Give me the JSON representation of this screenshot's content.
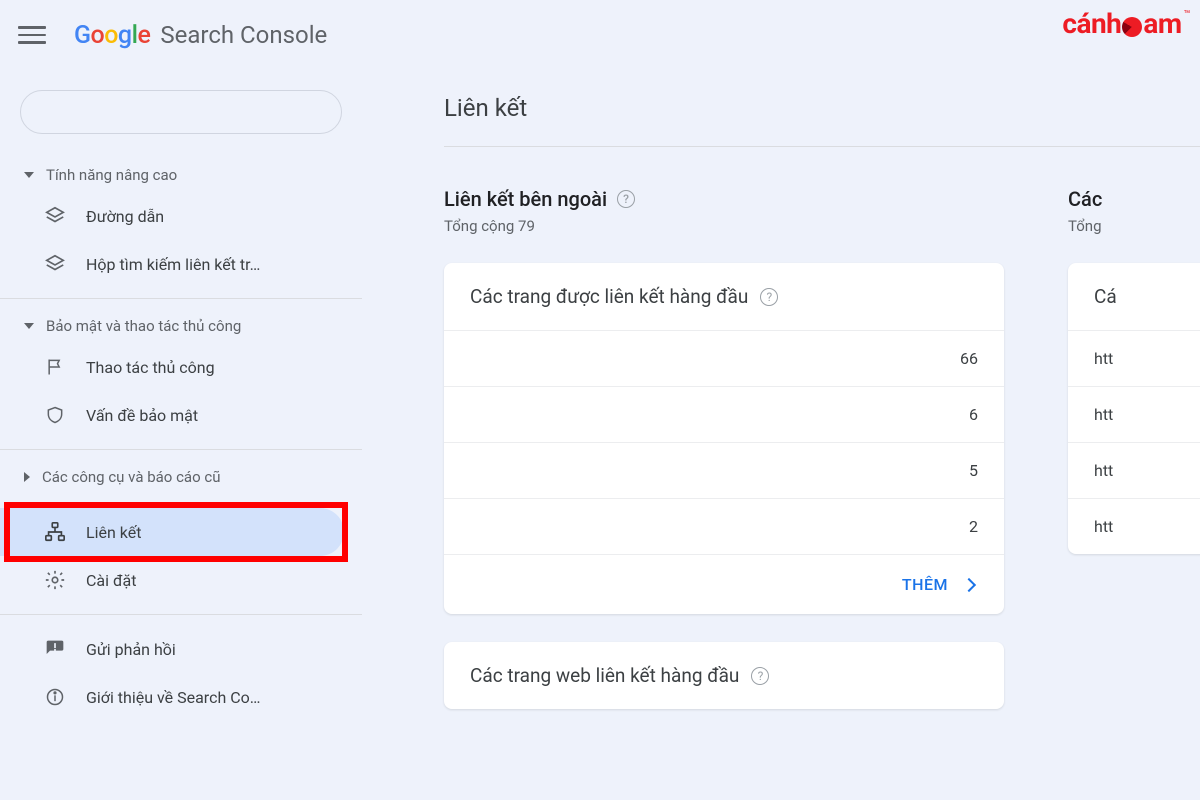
{
  "header": {
    "product_suffix": "Search Console",
    "brand_overlay": "cánh•am"
  },
  "sidebar": {
    "group_advanced": "Tính năng nâng cao",
    "item_breadcrumbs": "Đường dẫn",
    "item_sitelinks": "Hộp tìm kiếm liên kết tr…",
    "group_security": "Bảo mật và thao tác thủ công",
    "item_manual": "Thao tác thủ công",
    "item_security": "Vấn đề bảo mật",
    "group_legacy": "Các công cụ và báo cáo cũ",
    "item_links": "Liên kết",
    "item_settings": "Cài đặt",
    "item_feedback": "Gửi phản hồi",
    "item_about": "Giới thiệu về Search Co…"
  },
  "main": {
    "title": "Liên kết",
    "external": {
      "title": "Liên kết bên ngoài",
      "total_label": "Tổng cộng 79",
      "card1_title": "Các trang được liên kết hàng đầu",
      "rows": [
        {
          "url": "",
          "count": "66"
        },
        {
          "url": "",
          "count": "6"
        },
        {
          "url": "",
          "count": "5"
        },
        {
          "url": "",
          "count": "2"
        }
      ],
      "more": "THÊM",
      "card2_title": "Các trang web liên kết hàng đầu"
    },
    "internal": {
      "title_prefix": "Các",
      "total_label_prefix": "Tổng",
      "card1_title_prefix": "Cá",
      "rows": [
        {
          "url": "htt"
        },
        {
          "url": "htt"
        },
        {
          "url": "htt"
        },
        {
          "url": "htt"
        }
      ]
    }
  }
}
